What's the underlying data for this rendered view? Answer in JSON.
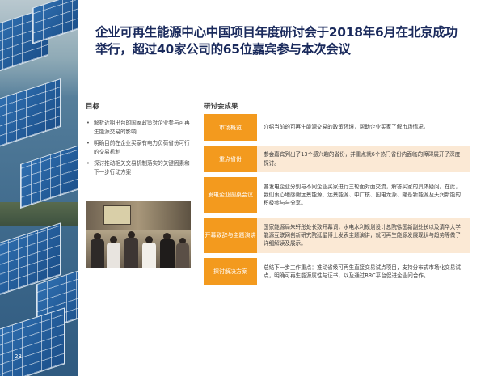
{
  "page": {
    "title": "企业可再生能源中心中国项目年度研讨会于2018年6月在北京成功举行，超过40家公司的65位嘉宾参与本次会议",
    "page_number": "23"
  },
  "goals": {
    "heading": "目标",
    "items": [
      "解析近期出台的国家政策对企业参与可再生能源交易的影响",
      "明确目前在企业买家有电力负荷省份可行的交易机制",
      "探讨推动相关交易机制落实的关键因素和下一步行动方案"
    ]
  },
  "results": {
    "heading": "研讨会成果",
    "rows": [
      {
        "label": "市场概览",
        "text": "介绍当前的可再生能源交易的政策环境，帮助企业买家了解市场情况。"
      },
      {
        "label": "重点省份",
        "text": "参会嘉宾列出了13个感兴趣的省份，并重点就6个热门省份内面临的障碍展开了深度探讨。"
      },
      {
        "label": "发电企业圆桌会议",
        "text": "各发电企业分别与不同企业买家进行三轮面对面交流，解答买家的具体疑问。在此，我们衷心地感谢远景能源、远景能源、中广核、国电龙源、隆基新能源及天润新能的积极参与与分享。"
      },
      {
        "label": "开幕致辞与主题演讲",
        "text": "国家能源局朱轩彤处长致开幕词，水电水利规划设计总院徐国新副处长以及清华大学能源互联网创新研究院延星博士发表主题演讲，就可再生能源发展现状与趋势等做了详细解读及展示。"
      },
      {
        "label": "探讨解决方案",
        "text": "总结下一步工作重点：推动省级可再生直接交易试点项目，支持分布式市场化交易试点，明确可再生能源属性与证书，以及通过BRC平台促进企业间合作。"
      }
    ]
  },
  "colors": {
    "accent": "#f39a1e",
    "shade": "#fbe9d5",
    "title": "#1a2a5c"
  },
  "images": {
    "left_photo": "solar-panels-photo",
    "event_photo": "conference-photo"
  }
}
